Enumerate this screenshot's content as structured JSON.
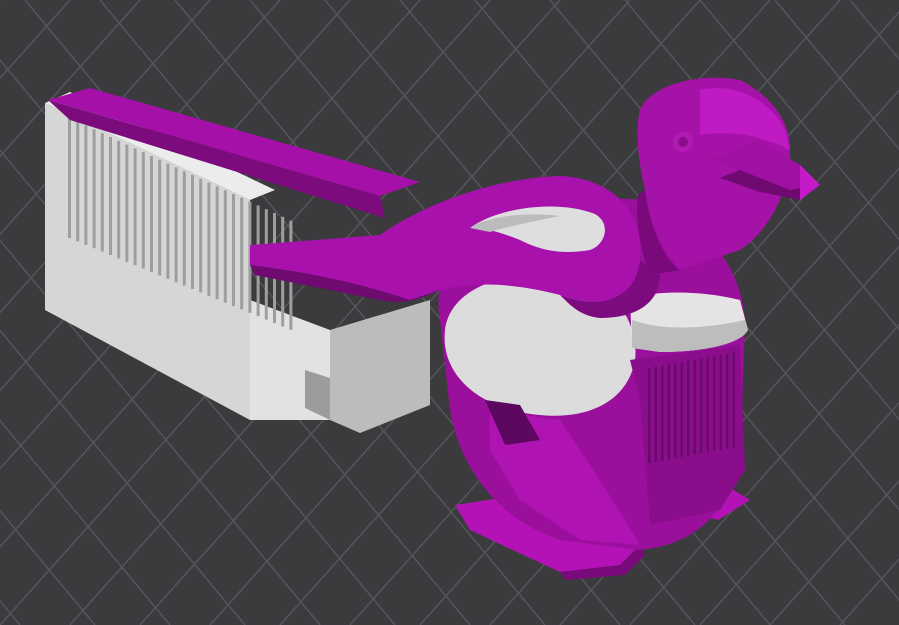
{
  "viewport": {
    "background": "#3b3b3e",
    "grid_color": "#55565a",
    "grid_visible": true,
    "projection": "perspective"
  },
  "model": {
    "colors": {
      "primary_body": "#9a0f9c",
      "primary_highlight": "#c018c4",
      "primary_shadow": "#6e0a70",
      "secondary_body": "#dcdcdc",
      "secondary_highlight": "#f0f0f0",
      "secondary_shadow": "#a8a8a8"
    },
    "parts": [
      {
        "name": "bird-body",
        "color": "primary"
      },
      {
        "name": "bird-head",
        "color": "primary"
      },
      {
        "name": "bird-beak",
        "color": "primary"
      },
      {
        "name": "bird-wing",
        "color": "primary"
      },
      {
        "name": "bird-tail-arm",
        "color": "primary"
      },
      {
        "name": "bird-feet",
        "color": "primary"
      },
      {
        "name": "bird-belly",
        "color": "secondary"
      },
      {
        "name": "bird-wing-patch",
        "color": "secondary"
      },
      {
        "name": "comb-block",
        "color": "secondary"
      }
    ]
  }
}
